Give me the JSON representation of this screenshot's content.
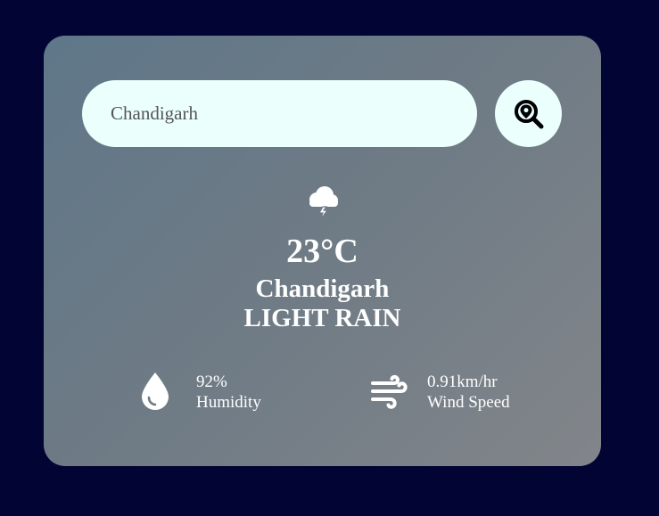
{
  "search": {
    "value": "Chandigarh",
    "button_icon": "map-pin-search-icon"
  },
  "weather": {
    "icon": "thunderstorm-cloud-icon",
    "temperature": "23°C",
    "city": "Chandigarh",
    "description": "LIGHT RAIN"
  },
  "humidity": {
    "icon": "water-drop-icon",
    "value": "92%",
    "label": "Humidity"
  },
  "wind": {
    "icon": "wind-icon",
    "value": "0.91km/hr",
    "label": "Wind Speed"
  },
  "colors": {
    "background": "#020433",
    "input_background": "#ebfffc",
    "text": "#ffffff"
  }
}
